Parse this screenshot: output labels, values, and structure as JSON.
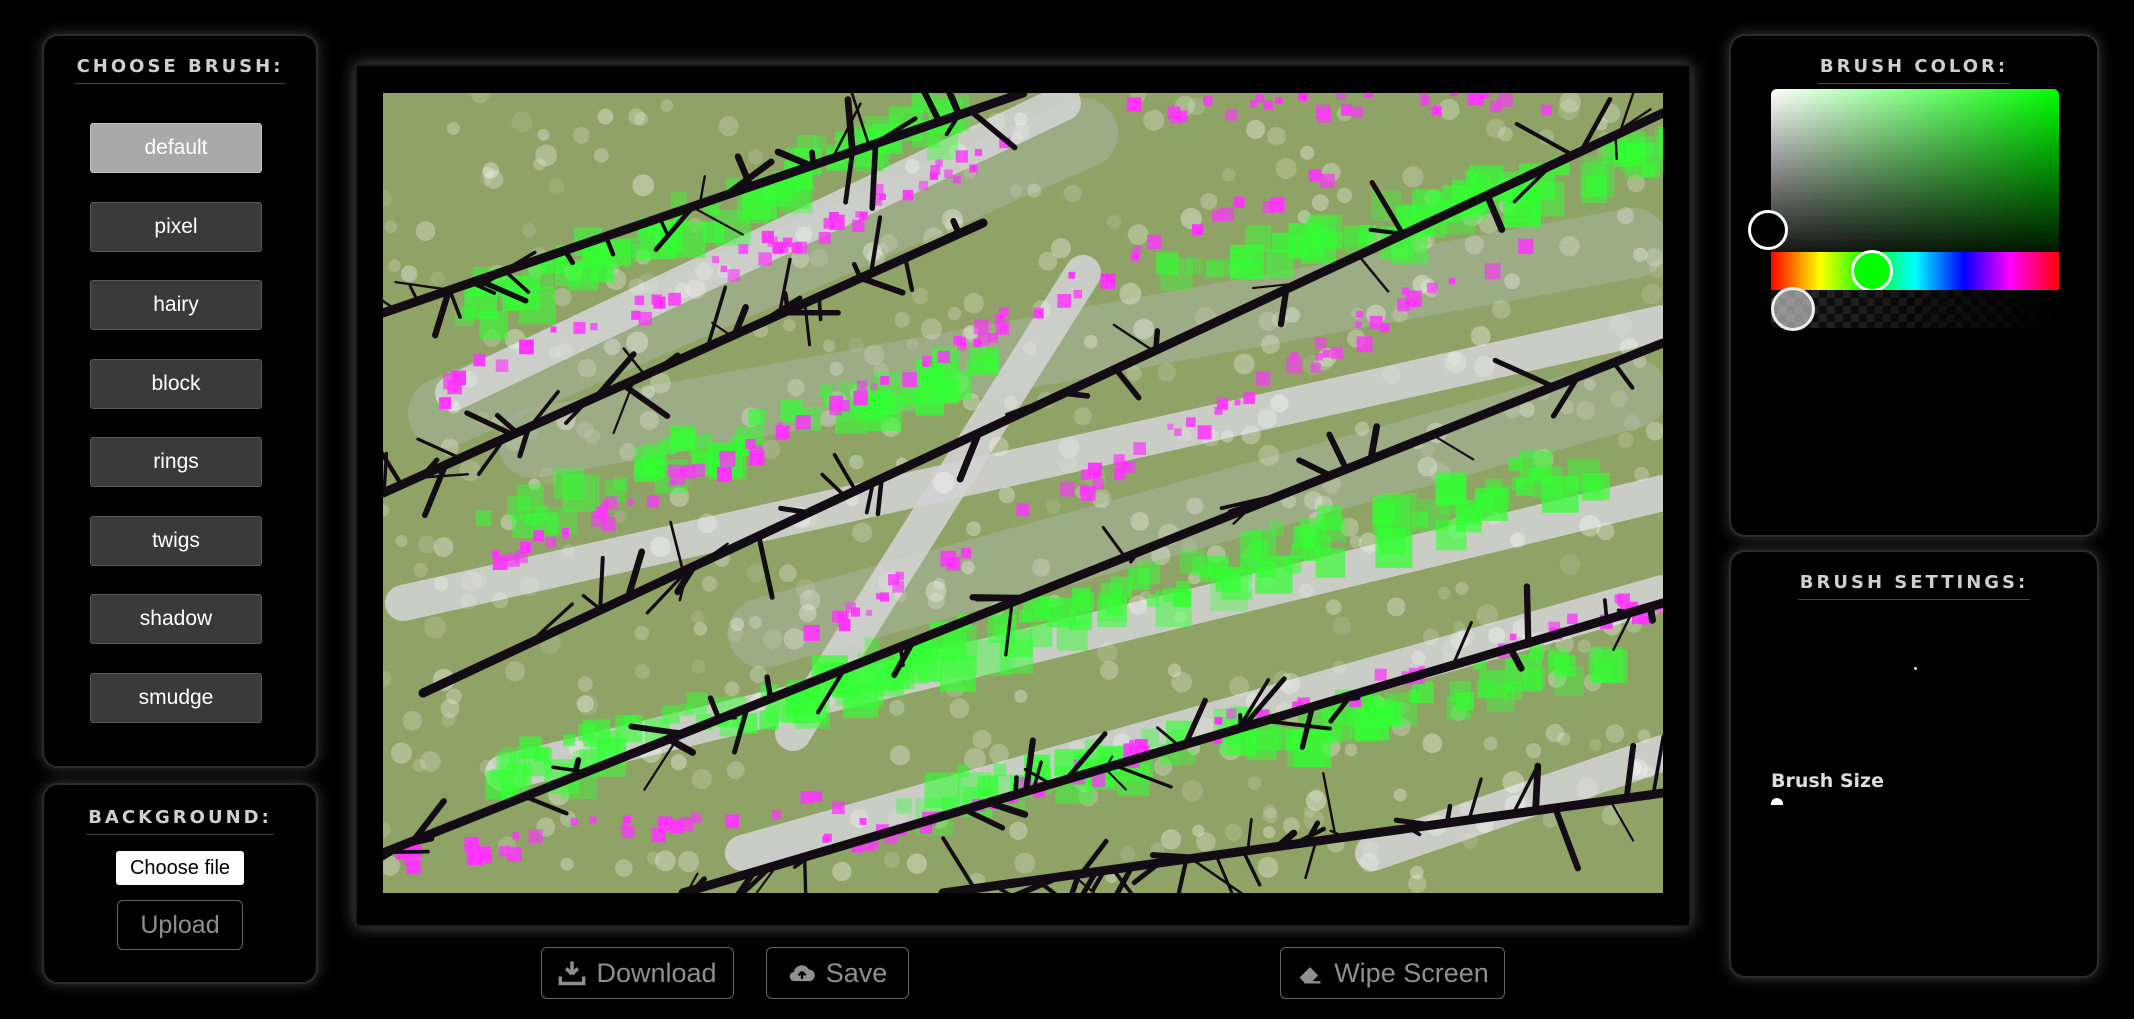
{
  "brush_panel": {
    "title": "CHOOSE BRUSH:",
    "brushes": [
      "default",
      "pixel",
      "hairy",
      "block",
      "rings",
      "twigs",
      "shadow",
      "smudge"
    ],
    "active": "default"
  },
  "background_panel": {
    "title": "BACKGROUND:",
    "choose_file_label": "Choose file",
    "upload_label": "Upload"
  },
  "actions": {
    "download_label": "Download",
    "download_icon": "download-icon",
    "save_label": "Save",
    "save_icon": "cloud-upload-icon",
    "wipe_label": "Wipe Screen",
    "wipe_icon": "eraser-icon"
  },
  "color_panel": {
    "title": "BRUSH COLOR:",
    "current_color": "#00ff00",
    "hue_degrees": 120,
    "alpha": 0.1
  },
  "settings_panel": {
    "title": "BRUSH SETTINGS:",
    "size_label": "Brush Size"
  },
  "canvas": {
    "background_color": "#8fa367",
    "stroke_colors": [
      "#d3d3d3",
      "#33ff33",
      "#ff33ff",
      "#140c14",
      "#ffffff"
    ]
  }
}
